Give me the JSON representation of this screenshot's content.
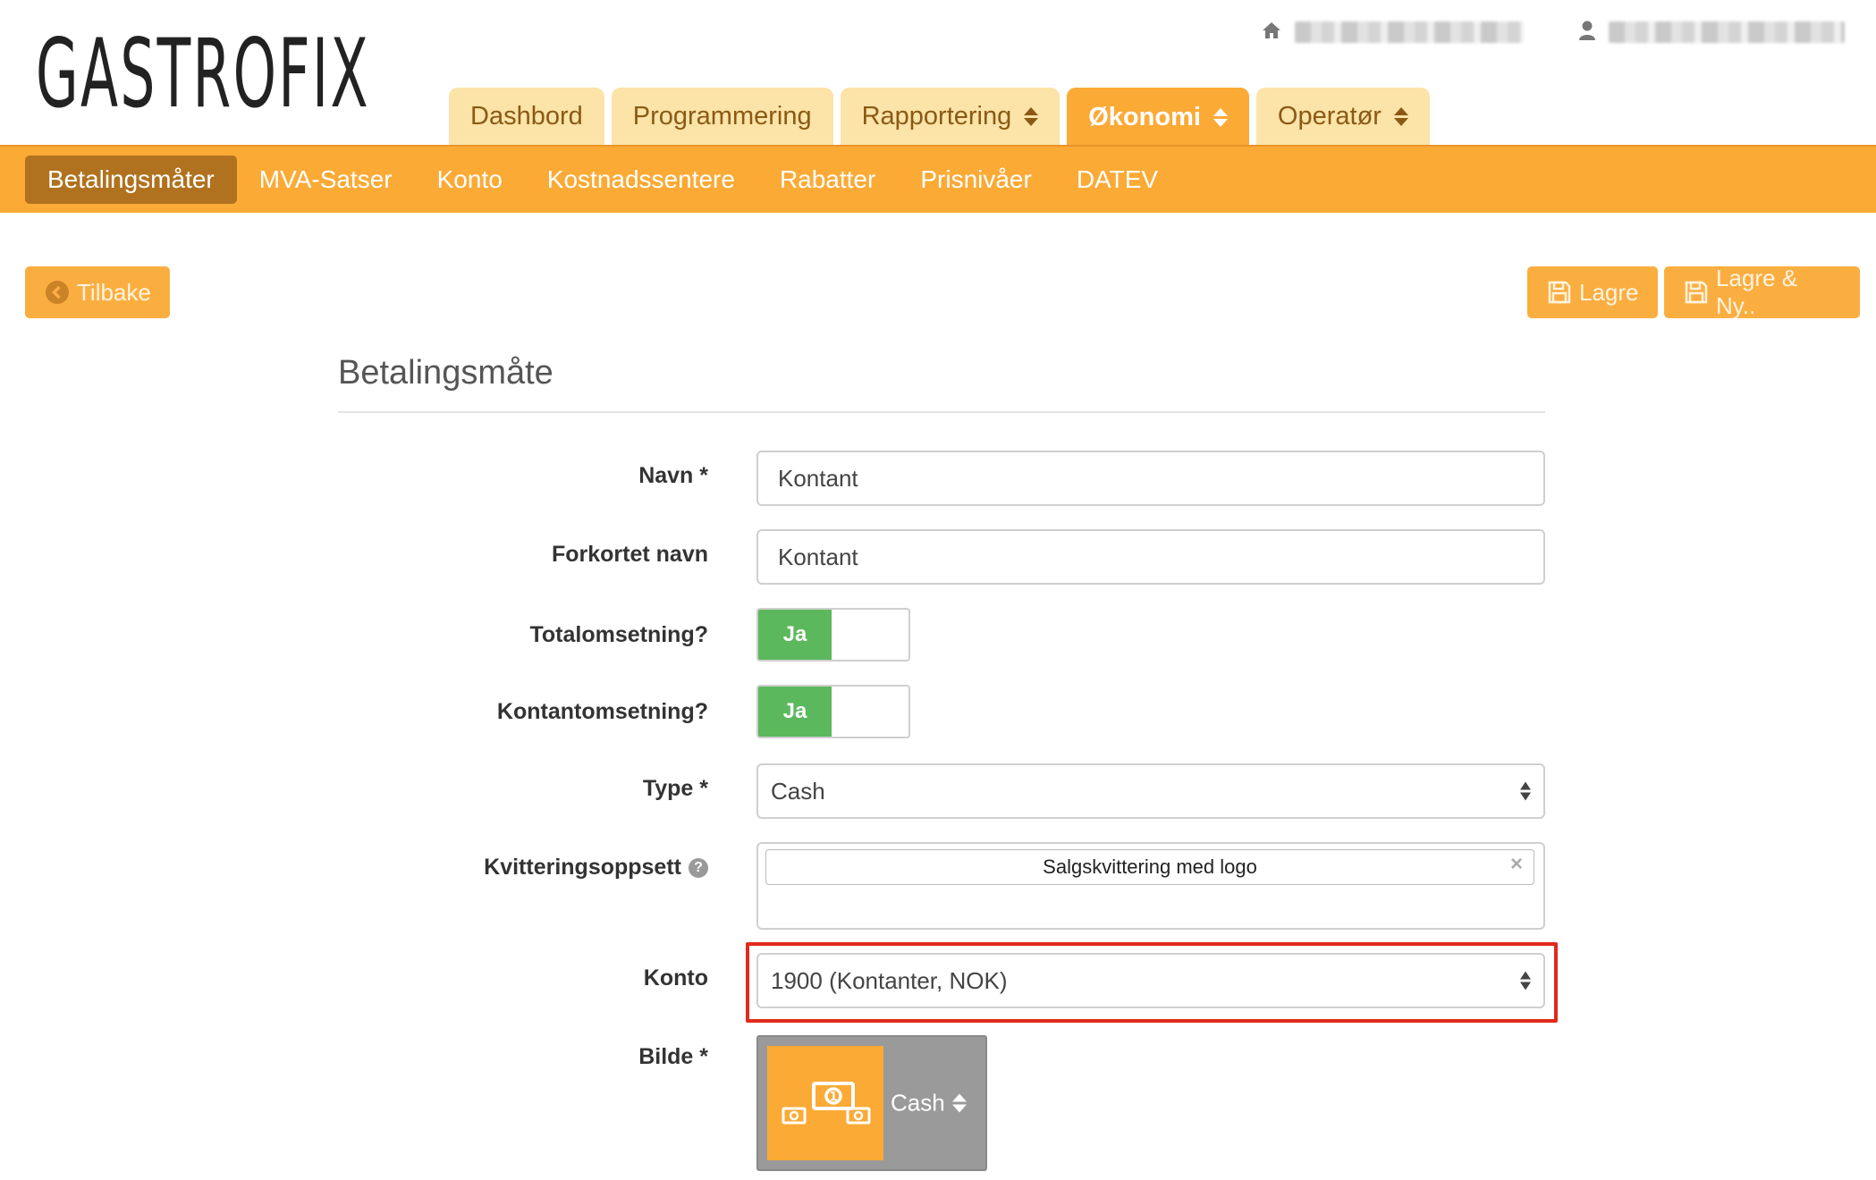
{
  "brand": {
    "logo_text": "GASTROFIX"
  },
  "user_area": {
    "home_icon": "home-icon",
    "user_icon": "user-icon"
  },
  "tabs": [
    {
      "label": "Dashbord",
      "active": false,
      "dropdown": false
    },
    {
      "label": "Programmering",
      "active": false,
      "dropdown": false
    },
    {
      "label": "Rapportering",
      "active": false,
      "dropdown": true
    },
    {
      "label": "Økonomi",
      "active": true,
      "dropdown": true
    },
    {
      "label": "Operatør",
      "active": false,
      "dropdown": true
    }
  ],
  "subnav": [
    {
      "label": "Betalingsmåter",
      "active": true
    },
    {
      "label": "MVA-Satser",
      "active": false
    },
    {
      "label": "Konto",
      "active": false
    },
    {
      "label": "Kostnadssentere",
      "active": false
    },
    {
      "label": "Rabatter",
      "active": false
    },
    {
      "label": "Prisnivåer",
      "active": false
    },
    {
      "label": "DATEV",
      "active": false
    }
  ],
  "actions": {
    "back_label": "Tilbake",
    "save_label": "Lagre",
    "save_new_label": "Lagre & Ny.."
  },
  "form": {
    "title": "Betalingsmåte",
    "name_label": "Navn *",
    "name_value": "Kontant",
    "short_name_label": "Forkortet navn",
    "short_name_value": "Kontant",
    "total_turnover_label": "Totalomsetning?",
    "total_turnover_value": "Ja",
    "cash_turnover_label": "Kontantomsetning?",
    "cash_turnover_value": "Ja",
    "type_label": "Type *",
    "type_value": "Cash",
    "receipt_layout_label": "Kvitteringsoppsett",
    "receipt_layout_selected": "Salgskvittering med logo",
    "account_label": "Konto",
    "account_value": "1900 (Kontanter, NOK)",
    "image_label": "Bilde *",
    "image_value": "Cash"
  },
  "colors": {
    "accent": "#fbaa36",
    "accent_dark": "#b0721f",
    "toggle_on": "#5cb85c",
    "highlight": "#e2291c"
  }
}
